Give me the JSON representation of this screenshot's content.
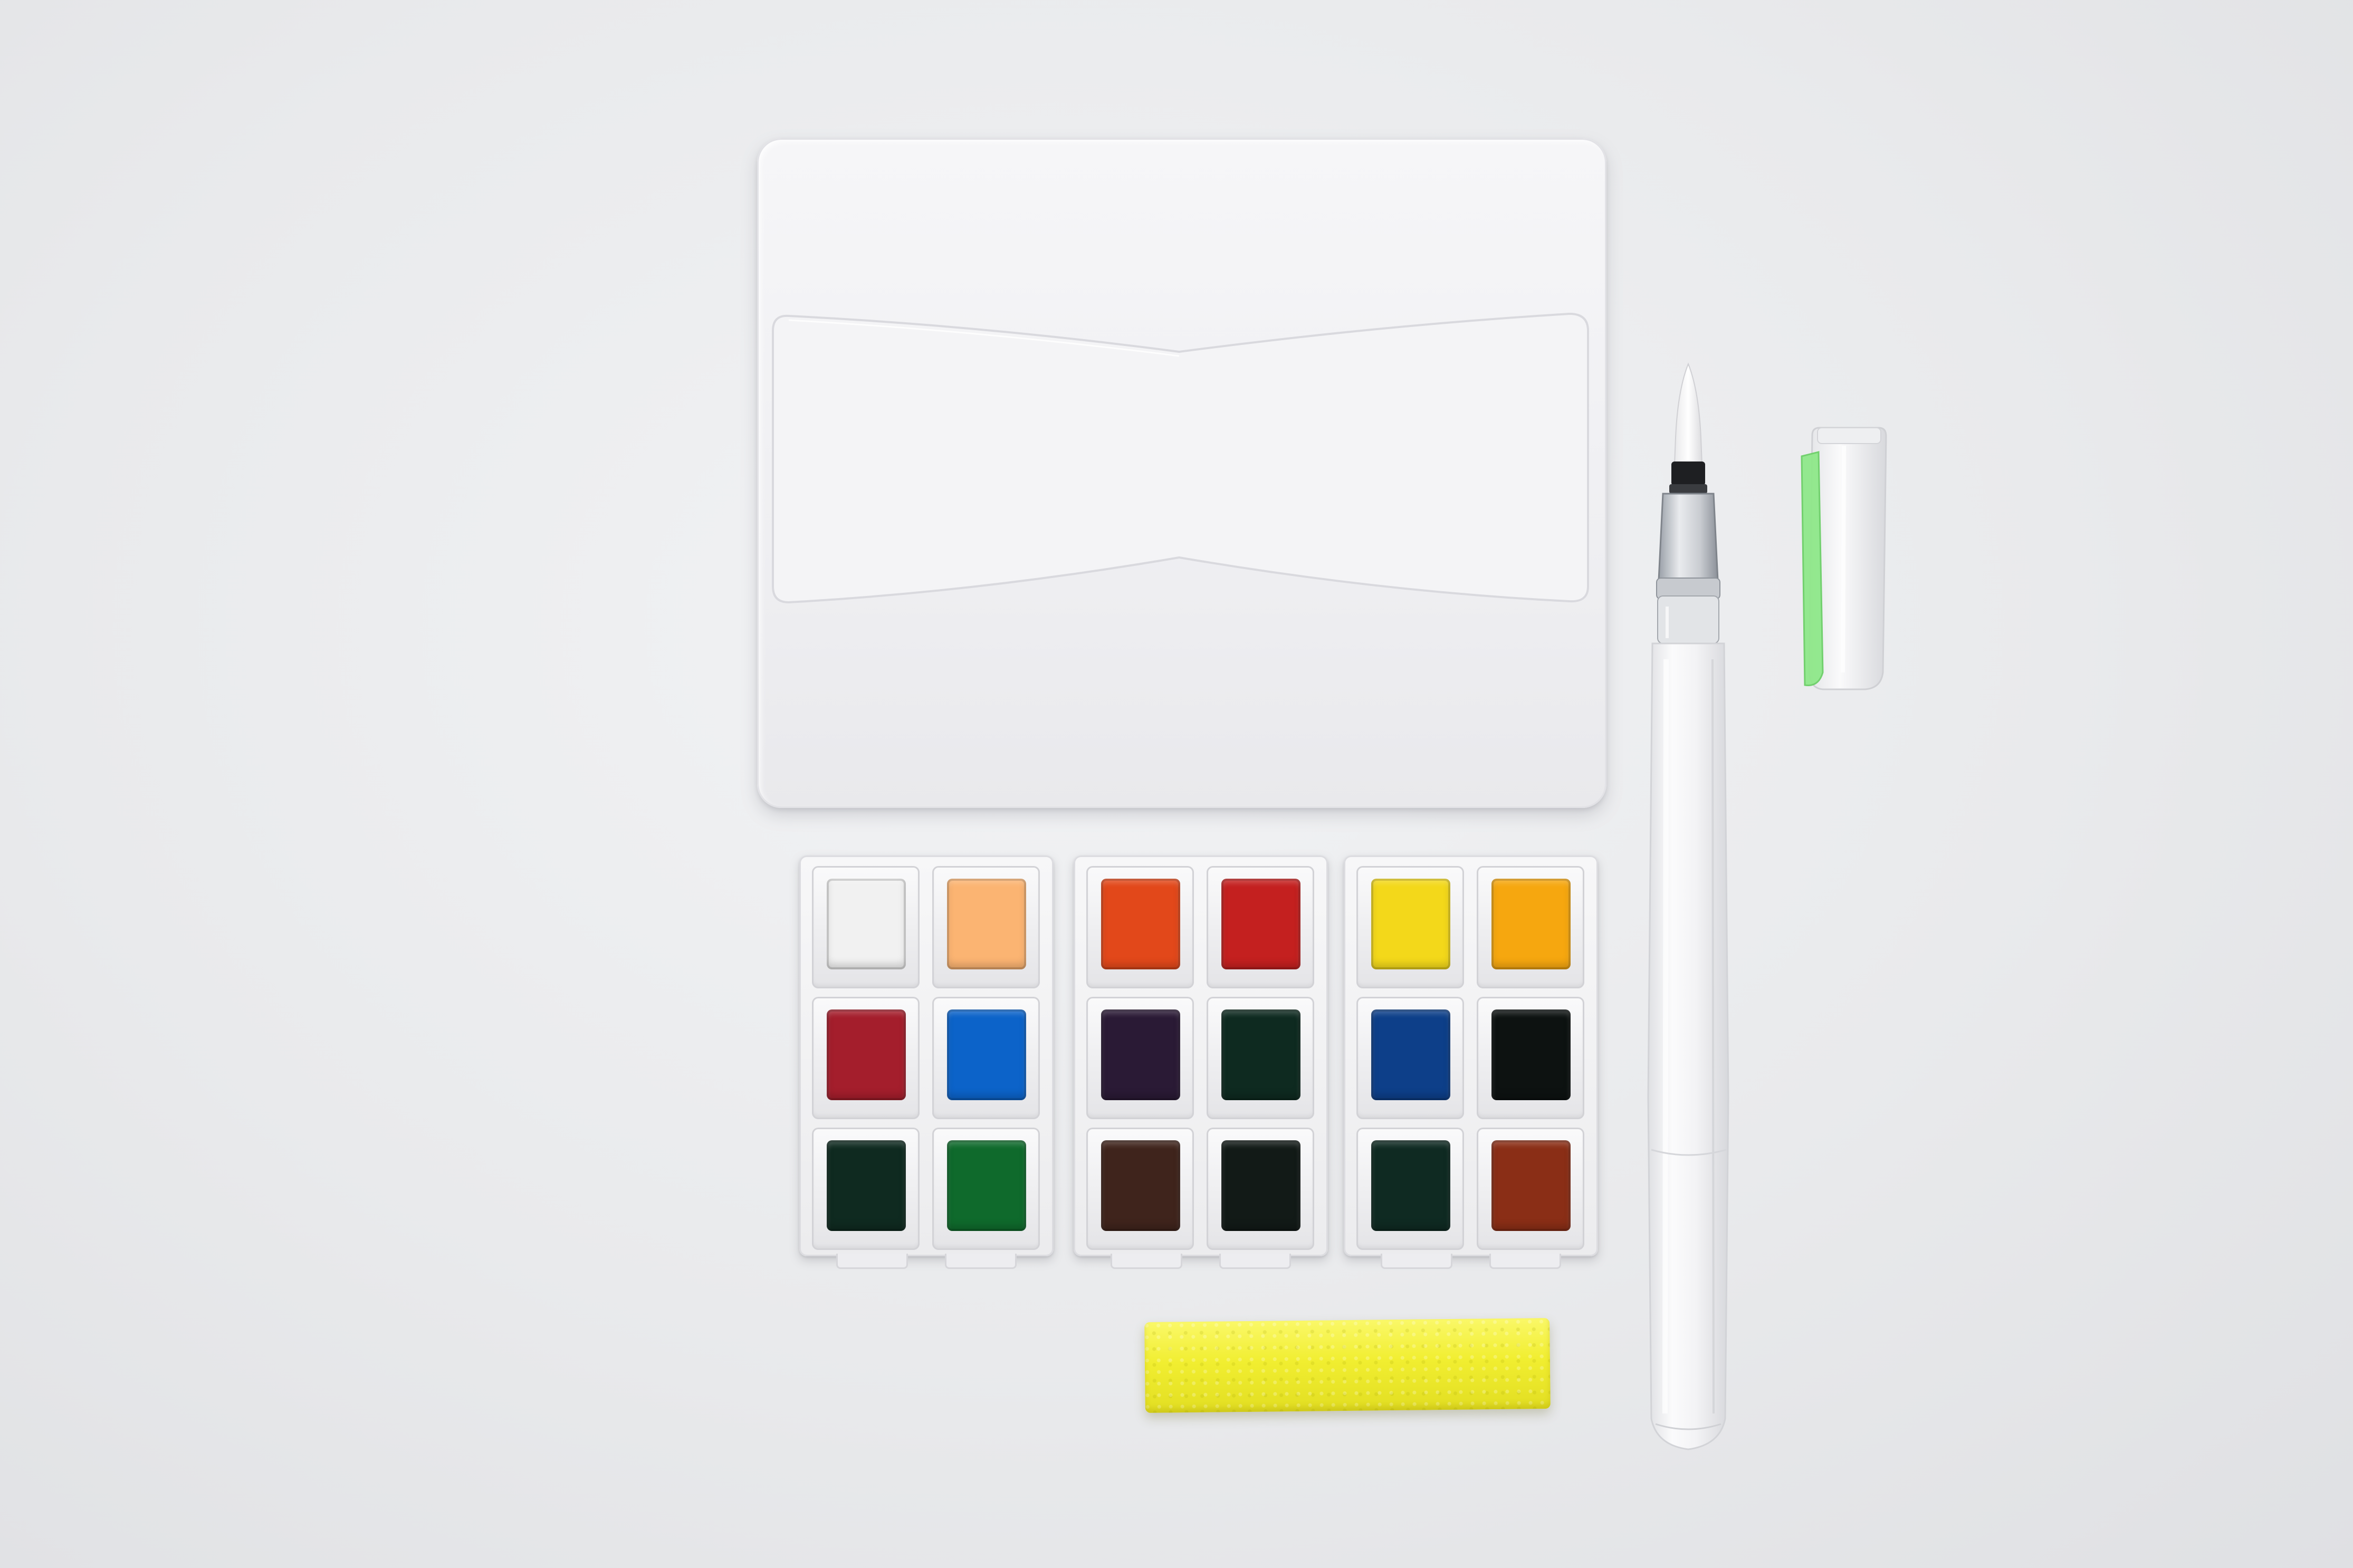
{
  "palette": {
    "trays": [
      {
        "rows": [
          {
            "left": "#f1f1f1",
            "right": "#fbb472"
          },
          {
            "left": "#a41e2c",
            "right": "#0c63c9"
          },
          {
            "left": "#0f2a20",
            "right": "#0f6a2c"
          }
        ]
      },
      {
        "rows": [
          {
            "left": "#e2481a",
            "right": "#c4201f"
          },
          {
            "left": "#2a1a35",
            "right": "#0e2a20"
          },
          {
            "left": "#3f241c",
            "right": "#121a17"
          }
        ]
      },
      {
        "rows": [
          {
            "left": "#f3d81a",
            "right": "#f6a70f"
          },
          {
            "left": "#0d3f89",
            "right": "#0d1211"
          },
          {
            "left": "#0f2a22",
            "right": "#8a2e16"
          }
        ]
      }
    ]
  },
  "brush": {
    "cap_accent_color": "#8fe88a"
  },
  "sponge": {
    "color": "#f1ee30"
  }
}
